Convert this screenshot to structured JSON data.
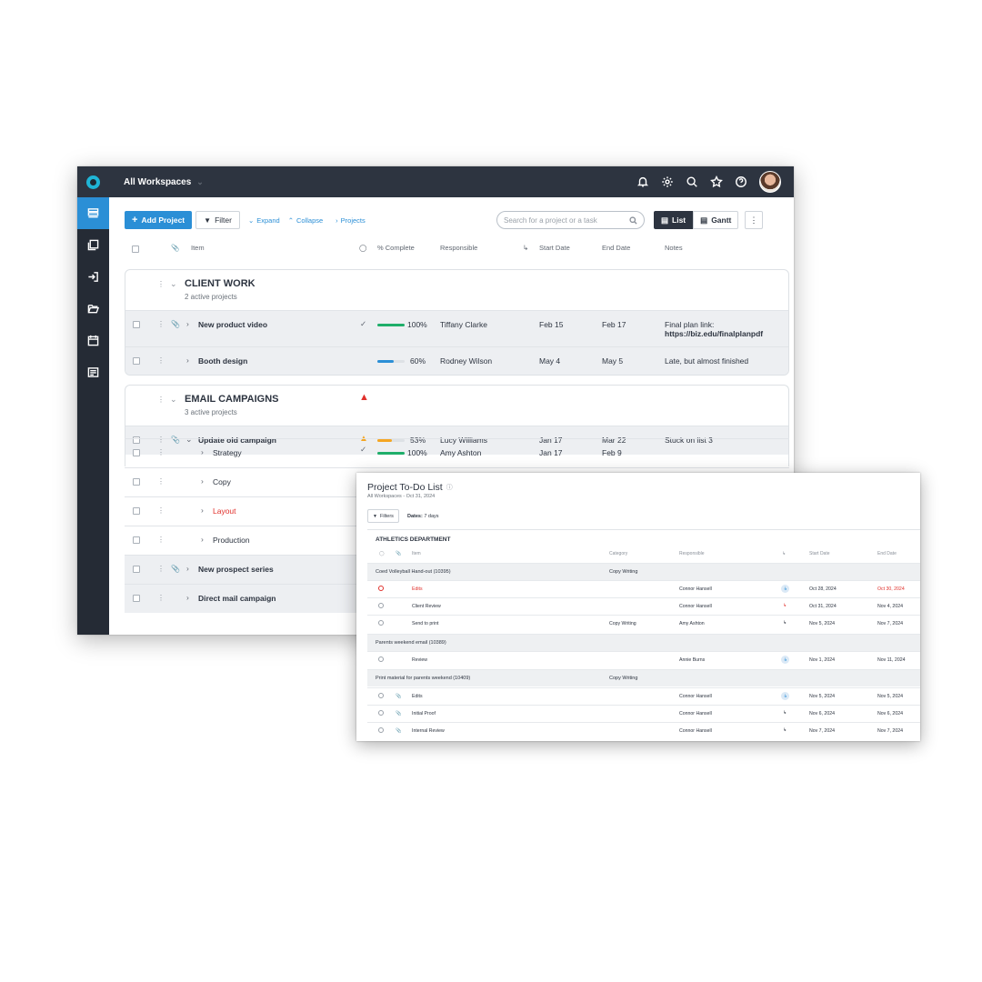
{
  "main": {
    "workspace_label": "All Workspaces",
    "toolbar": {
      "add_project": "Add Project",
      "filter": "Filter",
      "expand": "Expand",
      "collapse": "Collapse",
      "projects": "Projects",
      "search_placeholder": "Search for a project or a task",
      "view_list": "List",
      "view_gantt": "Gantt"
    },
    "columns": {
      "item": "Item",
      "complete": "% Complete",
      "responsible": "Responsible",
      "start": "Start Date",
      "end": "End Date",
      "notes": "Notes"
    },
    "groups": [
      {
        "title": "CLIENT WORK",
        "subtitle": "2 active projects",
        "rows": [
          {
            "name": "New product video",
            "percent": "100%",
            "progress": 1.0,
            "responsible": "Tiffany Clarke",
            "start": "Feb 15",
            "end": "Feb 17",
            "notes": "Final plan link:",
            "notes_link": "https://biz.edu/finalplanpdf"
          },
          {
            "name": "Booth design",
            "percent": "60%",
            "progress": 0.6,
            "responsible": "Rodney Wilson",
            "start": "May 4",
            "end": "May 5",
            "notes": "Late, but almost finished"
          }
        ]
      },
      {
        "title": "EMAIL CAMPAIGNS",
        "subtitle": "3 active projects",
        "rows": [
          {
            "name": "Update old campaign",
            "percent": "53%",
            "progress": 0.53,
            "responsible": "Lucy Williams",
            "start": "Jan 17",
            "end": "Mar 22",
            "notes": "Stuck on list 3"
          }
        ]
      }
    ],
    "subtasks": [
      {
        "name": "Strategy",
        "percent": "100%",
        "progress": 1.0,
        "responsible": "Amy Ashton",
        "start": "Jan 17",
        "end": "Feb 9"
      },
      {
        "name": "Copy"
      },
      {
        "name": "Layout"
      },
      {
        "name": "Production"
      }
    ],
    "more_projects": [
      {
        "name": "New prospect series"
      },
      {
        "name": "Direct mail campaign"
      }
    ],
    "colors": {
      "accent": "#2b8fd6",
      "sidebar": "#252b35",
      "topbar": "#2d3440",
      "green": "#1fae6a",
      "orange": "#f5a623",
      "red": "#e0302b"
    }
  },
  "todo": {
    "title": "Project To-Do List",
    "subtitle": "All Workspaces - Oct 31, 2024",
    "filters": "Filters",
    "dates_label": "Dates:",
    "dates_value": "7 days",
    "department": "ATHLETICS DEPARTMENT",
    "columns": {
      "item": "Item",
      "category": "Category",
      "responsible": "Responsible",
      "start": "Start Date",
      "end": "End Date"
    },
    "projects": [
      {
        "title": "Coed Volleyball Hand-out (10395)",
        "category": "Copy Writing",
        "tasks": [
          {
            "name": "Edits",
            "category": "",
            "responsible": "Connor Hansell",
            "start": "Oct 28, 2024",
            "end": "Oct 30, 2024"
          },
          {
            "name": "Client Review",
            "category": "",
            "responsible": "Connor Hansell",
            "start": "Oct 31, 2024",
            "end": "Nov 4, 2024"
          },
          {
            "name": "Send to print",
            "category": "Copy Writing",
            "responsible": "Amy Ashton",
            "start": "Nov 5, 2024",
            "end": "Nov 7, 2024"
          }
        ]
      },
      {
        "title": "Parents weekend email (10389)",
        "category": "",
        "tasks": [
          {
            "name": "Review",
            "category": "",
            "responsible": "Annie Burns",
            "start": "Nov 1, 2024",
            "end": "Nov 11, 2024"
          }
        ]
      },
      {
        "title": "Print material for parents weekend (10409)",
        "category": "Copy Writing",
        "tasks": [
          {
            "name": "Edits",
            "category": "",
            "responsible": "Connor Hansell",
            "start": "Nov 5, 2024",
            "end": "Nov 5, 2024"
          },
          {
            "name": "Initial Proof",
            "category": "",
            "responsible": "Connor Hansell",
            "start": "Nov 6, 2024",
            "end": "Nov 6, 2024"
          },
          {
            "name": "Internal Review",
            "category": "",
            "responsible": "Connor Hansell",
            "start": "Nov 7, 2024",
            "end": "Nov 7, 2024"
          }
        ]
      }
    ]
  }
}
